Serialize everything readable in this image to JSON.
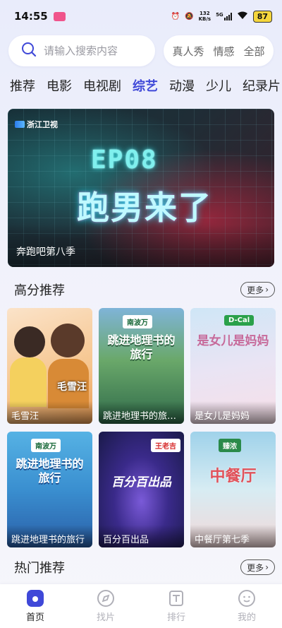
{
  "status_bar": {
    "time": "14:55",
    "net_speed_value": "132",
    "net_speed_unit": "KB/s",
    "signal_label": "5G",
    "battery": "87"
  },
  "search": {
    "placeholder": "请输入搜索内容",
    "hot_words": [
      "真人秀",
      "情感",
      "全部"
    ]
  },
  "tabs": [
    {
      "label": "推荐"
    },
    {
      "label": "电影"
    },
    {
      "label": "电视剧"
    },
    {
      "label": "综艺"
    },
    {
      "label": "动漫"
    },
    {
      "label": "少儿"
    },
    {
      "label": "纪录片"
    }
  ],
  "active_tab": "综艺",
  "banner": {
    "channel": "浙江卫视",
    "art_line1": "EP08",
    "art_line2": "跑男来了",
    "caption": "奔跑吧第八季"
  },
  "high_score": {
    "title": "高分推荐",
    "more_label": "更多",
    "items": [
      {
        "title": "毛雪汪",
        "art": "毛雪汪",
        "colors": [
          "#f7d7b6",
          "#f2a35c"
        ]
      },
      {
        "title": "跳进地理书的旅行第二季",
        "art": "跳进地理书的旅行",
        "brand": "南波万",
        "colors": [
          "#5a9a5a",
          "#3c7a8a"
        ]
      },
      {
        "title": "是女儿是妈妈",
        "art": "是女儿是妈妈",
        "brand": "D-Cal",
        "colors": [
          "#cfe4f4",
          "#f0e6f0"
        ]
      },
      {
        "title": "跳进地理书的旅行",
        "art": "跳进地理书的旅行",
        "brand": "南波万",
        "colors": [
          "#3aa0d8",
          "#2a6ab0"
        ]
      },
      {
        "title": "百分百出品",
        "art": "百分百出品",
        "brand": "王老吉",
        "colors": [
          "#2a2a6a",
          "#6a3aa8"
        ]
      },
      {
        "title": "中餐厅第七季",
        "art": "中餐厅",
        "brand": "臻浓",
        "colors": [
          "#bfe0f0",
          "#f0c0c0"
        ]
      }
    ]
  },
  "hot": {
    "title": "热门推荐",
    "more_label": "更多"
  },
  "bottom_nav": [
    {
      "label": "首页",
      "icon": "home-icon",
      "active": true
    },
    {
      "label": "找片",
      "icon": "compass-icon",
      "active": false
    },
    {
      "label": "排行",
      "icon": "ranking-icon",
      "active": false
    },
    {
      "label": "我的",
      "icon": "profile-icon",
      "active": false
    }
  ],
  "colors": {
    "accent": "#3f48d8",
    "inactive_nav": "#b0b0b8"
  }
}
